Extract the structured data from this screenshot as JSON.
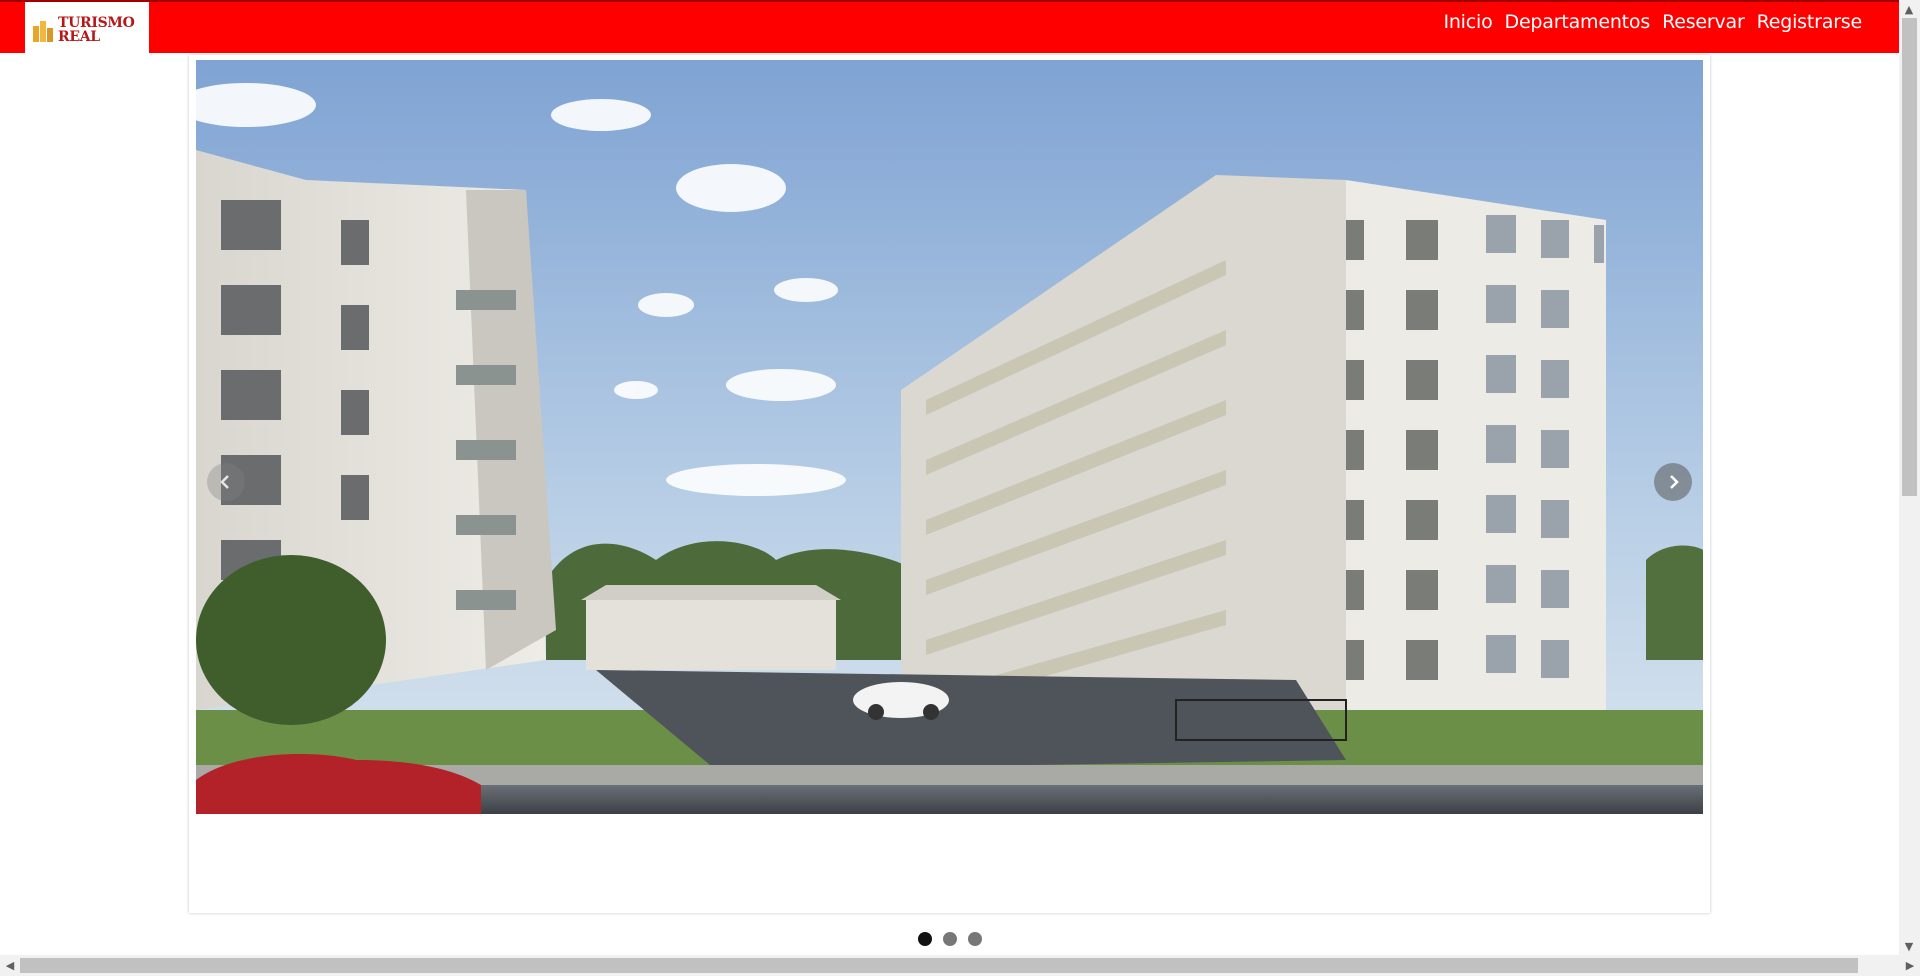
{
  "header": {
    "brand": {
      "line1": "TURISMO",
      "line2": "REAL",
      "icon": "buildings-icon"
    },
    "nav": [
      {
        "label": "Inicio"
      },
      {
        "label": "Departamentos"
      },
      {
        "label": "Reservar"
      },
      {
        "label": "Registrarse"
      }
    ],
    "colors": {
      "bar": "#ff0000",
      "brand_text": "#b81717",
      "logo_accent": "#e8a52a"
    }
  },
  "carousel": {
    "slides_count": 3,
    "active_index": 0,
    "prev_icon": "chevron-left-icon",
    "next_icon": "chevron-right-icon",
    "slide_image": "apartment-buildings-render"
  }
}
